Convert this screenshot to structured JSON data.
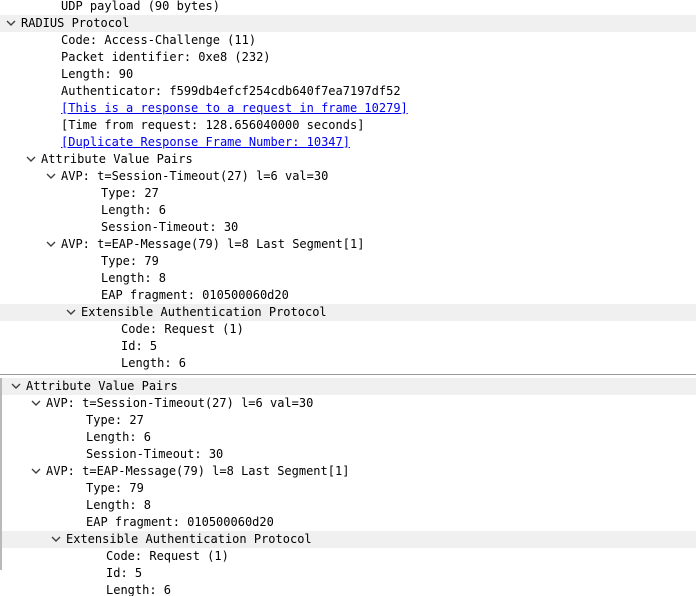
{
  "top_pane": {
    "rows": [
      {
        "text": "UDP payload (90 bytes)",
        "level": 2,
        "expander": "none"
      },
      {
        "text": "RADIUS Protocol",
        "level": 0,
        "expander": "expanded",
        "highlighted": true
      },
      {
        "text": "Code: Access-Challenge (11)",
        "level": 2,
        "expander": "none"
      },
      {
        "text": "Packet identifier: 0xe8 (232)",
        "level": 2,
        "expander": "none"
      },
      {
        "text": "Length: 90",
        "level": 2,
        "expander": "none"
      },
      {
        "text": "Authenticator: f599db4efcf254cdb640f7ea7197df52",
        "level": 2,
        "expander": "none"
      },
      {
        "text": "[This is a response to a request in frame 10279]",
        "level": 2,
        "expander": "none",
        "link": true
      },
      {
        "text": "[Time from request: 128.656040000 seconds]",
        "level": 2,
        "expander": "none"
      },
      {
        "text": "[Duplicate Response Frame Number: 10347]",
        "level": 2,
        "expander": "none",
        "link": true
      },
      {
        "text": "Attribute Value Pairs",
        "level": 1,
        "expander": "expanded"
      },
      {
        "text": "AVP: t=Session-Timeout(27) l=6 val=30",
        "level": 2,
        "expander": "expanded"
      },
      {
        "text": "Type: 27",
        "level": 4,
        "expander": "none"
      },
      {
        "text": "Length: 6",
        "level": 4,
        "expander": "none"
      },
      {
        "text": "Session-Timeout: 30",
        "level": 4,
        "expander": "none"
      },
      {
        "text": "AVP: t=EAP-Message(79) l=8 Last Segment[1]",
        "level": 2,
        "expander": "expanded"
      },
      {
        "text": "Type: 79",
        "level": 4,
        "expander": "none"
      },
      {
        "text": "Length: 8",
        "level": 4,
        "expander": "none"
      },
      {
        "text": "EAP fragment: 010500060d20",
        "level": 4,
        "expander": "none"
      },
      {
        "text": "Extensible Authentication Protocol",
        "level": 3,
        "expander": "expanded",
        "highlighted": true
      },
      {
        "text": "Code: Request (1)",
        "level": 5,
        "expander": "none"
      },
      {
        "text": "Id: 5",
        "level": 5,
        "expander": "none"
      },
      {
        "text": "Length: 6",
        "level": 5,
        "expander": "none"
      }
    ]
  },
  "bottom_pane": {
    "rows": [
      {
        "text": "Attribute Value Pairs",
        "level": 0,
        "expander": "expanded",
        "highlighted": true
      },
      {
        "text": "AVP: t=Session-Timeout(27) l=6 val=30",
        "level": 1,
        "expander": "expanded"
      },
      {
        "text": "Type: 27",
        "level": 3,
        "expander": "none"
      },
      {
        "text": "Length: 6",
        "level": 3,
        "expander": "none"
      },
      {
        "text": "Session-Timeout: 30",
        "level": 3,
        "expander": "none"
      },
      {
        "text": "AVP: t=EAP-Message(79) l=8 Last Segment[1]",
        "level": 1,
        "expander": "expanded"
      },
      {
        "text": "Type: 79",
        "level": 3,
        "expander": "none"
      },
      {
        "text": "Length: 8",
        "level": 3,
        "expander": "none"
      },
      {
        "text": "EAP fragment: 010500060d20",
        "level": 3,
        "expander": "none"
      },
      {
        "text": "Extensible Authentication Protocol",
        "level": 2,
        "expander": "expanded",
        "highlighted": true
      },
      {
        "text": "Code: Request (1)",
        "level": 4,
        "expander": "none"
      },
      {
        "text": "Id: 5",
        "level": 4,
        "expander": "none"
      },
      {
        "text": "Length: 6",
        "level": 4,
        "expander": "none"
      }
    ]
  }
}
